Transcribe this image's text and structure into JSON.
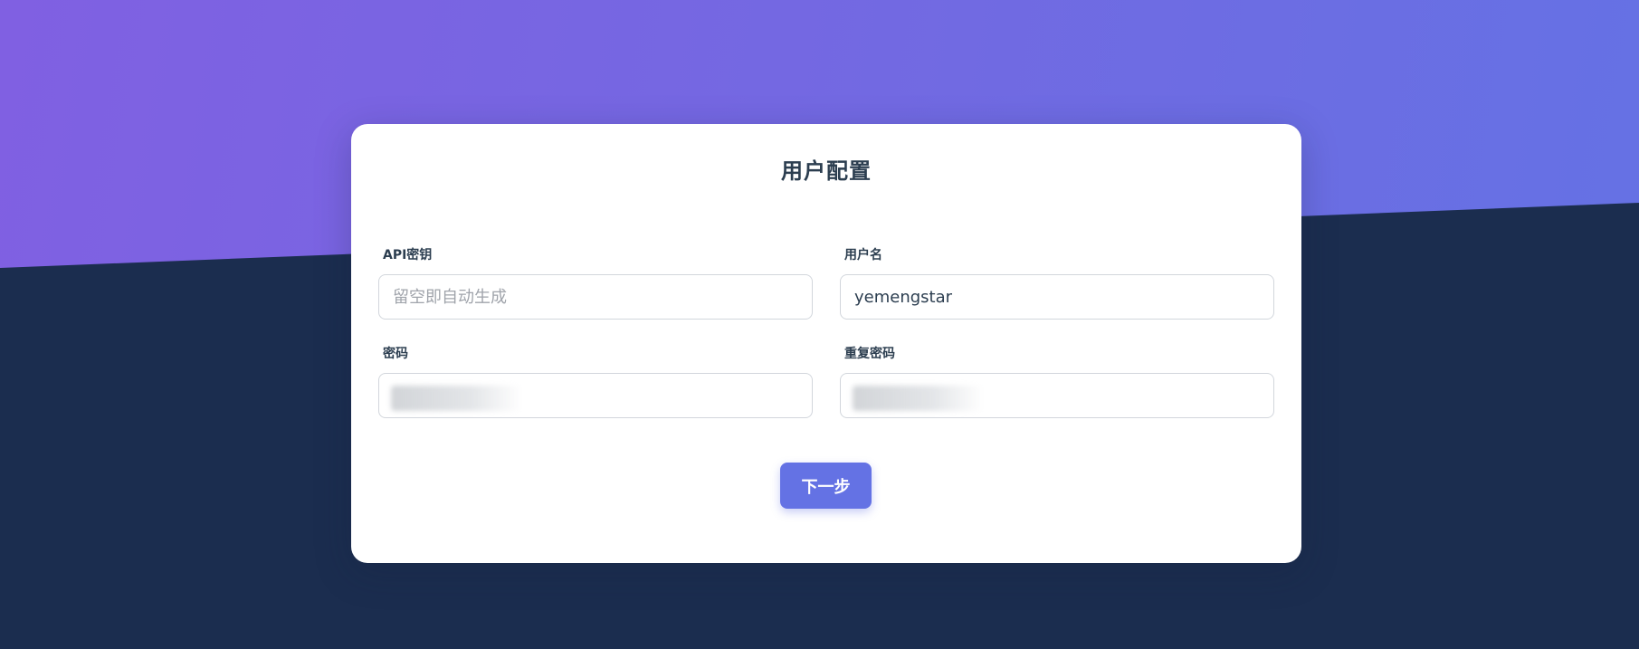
{
  "page": {
    "title": "用户配置"
  },
  "form": {
    "api_key": {
      "label": "API密钥",
      "value": "",
      "placeholder": "留空即自动生成"
    },
    "username": {
      "label": "用户名",
      "value": "yemengstar",
      "placeholder": ""
    },
    "password": {
      "label": "密码",
      "value": "",
      "obscured": true
    },
    "repeat_password": {
      "label": "重复密码",
      "value": "",
      "obscured": true
    }
  },
  "actions": {
    "next_label": "下一步"
  },
  "colors": {
    "gradient_start": "#8060e2",
    "gradient_end": "#6472e4",
    "background_dark": "#1b2d4f",
    "button": "#6472e4",
    "heading_text": "#2c3e50"
  }
}
